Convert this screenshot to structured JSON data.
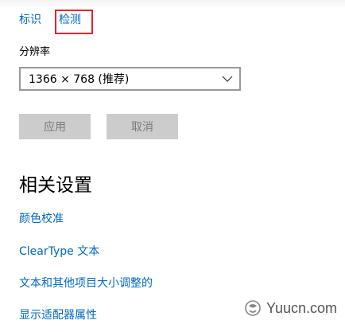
{
  "tabs": {
    "identify": "标识",
    "detect": "检测"
  },
  "resolution": {
    "label": "分辨率",
    "value": "1366 × 768 (推荐)"
  },
  "buttons": {
    "apply": "应用",
    "cancel": "取消"
  },
  "related": {
    "title": "相关设置",
    "links": [
      "颜色校准",
      "ClearType 文本",
      "文本和其他项目大小调整的",
      "显示适配器属性"
    ]
  },
  "watermark": {
    "text": "Yuucn.com"
  },
  "colors": {
    "accent": "#0067c0",
    "highlight": "#e8222b",
    "button_bg": "#cccccc",
    "button_text": "#7a7a7a"
  }
}
